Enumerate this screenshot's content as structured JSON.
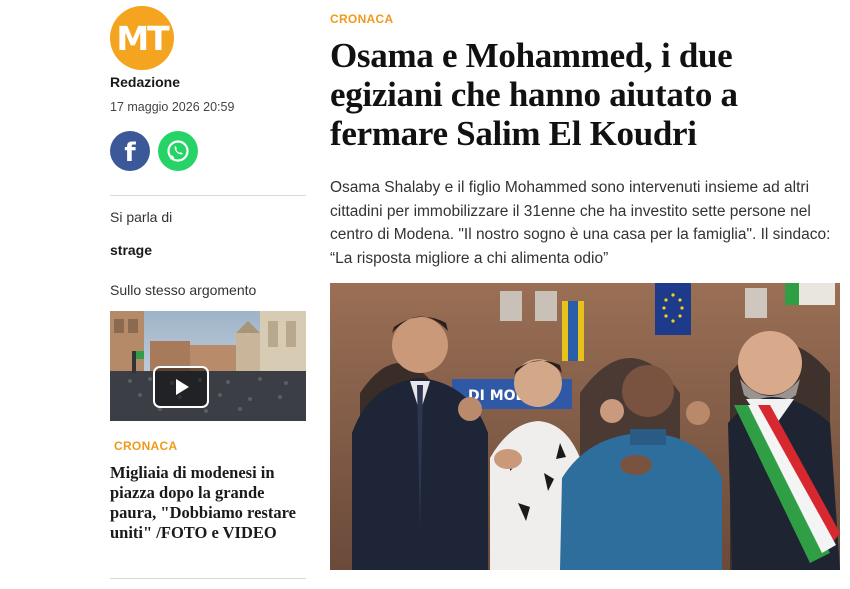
{
  "brand": {
    "logo_text": "MT",
    "logo_color": "#f4a41e"
  },
  "byline": {
    "author": "Redazione",
    "date": "17 maggio 2026 20:59"
  },
  "share": {
    "facebook_icon": "facebook-icon",
    "whatsapp_icon": "whatsapp-icon"
  },
  "sidebar": {
    "topic_label": "Si parla di",
    "topic_tag": "strage",
    "related_label": "Sullo stesso argomento",
    "related": {
      "kicker": "CRONACA",
      "title": "Migliaia di modenesi in piazza dopo la grande paura, \"Dobbiamo restare uniti\" /FOTO e VIDEO",
      "has_video": true
    }
  },
  "article": {
    "kicker": "CRONACA",
    "title": "Osama e Mohammed, i due egiziani che hanno aiutato a fermare Salim El Koudri",
    "summary": "Osama Shalaby e il figlio Mohammed sono intervenuti insieme ad altri cittadini per immobilizzare il 31enne che ha investito sette persone nel centro di Modena. \"Il nostro sogno è una casa per la famiglia\". Il sindaco: “La risposta migliore a chi alimenta odio”",
    "photo_banner_text": "DI MODE"
  },
  "colors": {
    "accent": "#f09a1a",
    "facebook": "#3b5998",
    "whatsapp": "#25d366"
  }
}
